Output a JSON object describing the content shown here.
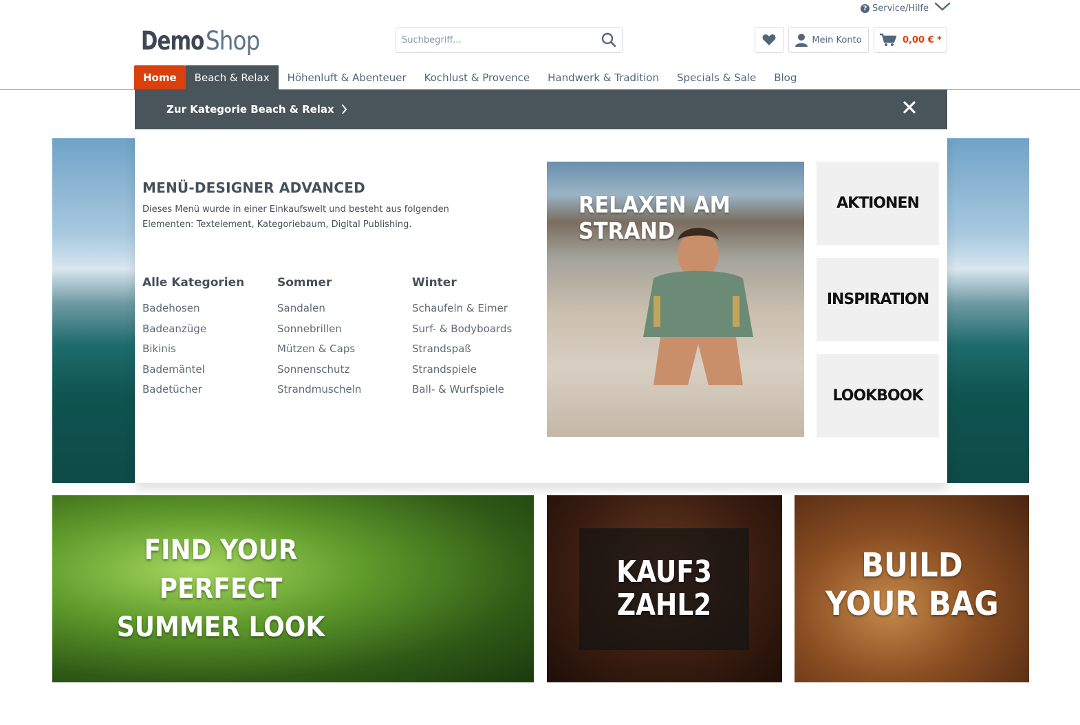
{
  "service": {
    "label": "Service/Hilfe"
  },
  "logo": {
    "part1": "Demo",
    "part2": "Shop"
  },
  "search": {
    "placeholder": "Suchbegriff..."
  },
  "header": {
    "account_label": "Mein Konto",
    "cart_total": "0,00 € *"
  },
  "nav": {
    "items": [
      {
        "label": "Home"
      },
      {
        "label": "Beach & Relax"
      },
      {
        "label": "Höhenluft & Abenteuer"
      },
      {
        "label": "Kochlust & Provence"
      },
      {
        "label": "Handwerk & Tradition"
      },
      {
        "label": "Specials & Sale"
      },
      {
        "label": "Blog"
      }
    ]
  },
  "menu": {
    "category_link": "Zur Kategorie Beach & Relax",
    "title": "MENÜ-DESIGNER ADVANCED",
    "description": "Dieses Menü wurde in einer Einkaufswelt und besteht aus folgenden Elementen: Textelement, Kategoriebaum, Digital Publishing.",
    "columns": [
      {
        "heading": "Alle Kategorien",
        "items": [
          "Badehosen",
          "Badeanzüge",
          "Bikinis",
          "Bademäntel",
          "Badetücher"
        ]
      },
      {
        "heading": "Sommer",
        "items": [
          "Sandalen",
          "Sonnebrillen",
          "Mützen & Caps",
          "Sonnenschutz",
          "Strandmuscheln"
        ]
      },
      {
        "heading": "Winter",
        "items": [
          "Schaufeln & Eimer",
          "Surf- & Bodyboards",
          "Strandspaß",
          "Strandspiele",
          "Ball- & Wurfspiele"
        ]
      }
    ],
    "image_label_line1": "RELAXEN AM",
    "image_label_line2": "STRAND",
    "tiles": [
      "AKTIONEN",
      "INSPIRATION",
      "LOOKBOOK"
    ]
  },
  "banners": {
    "summer": [
      "FIND YOUR",
      "PERFECT",
      "SUMMER LOOK"
    ],
    "kauf": [
      "KAUF3",
      "ZAHL2"
    ],
    "bag": [
      "BUILD",
      "YOUR BAG"
    ]
  }
}
